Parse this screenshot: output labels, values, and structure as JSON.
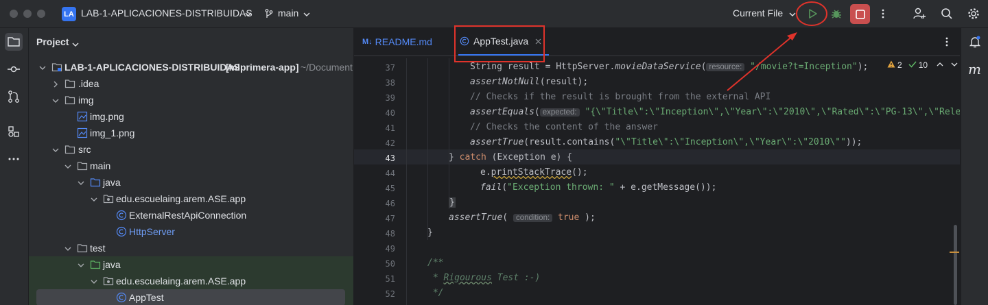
{
  "titlebar": {
    "project_badge": "LA",
    "project_name": "LAB-1-APLICACIONES-DISTRIBUIDAS",
    "branch": "main",
    "run_config": "Current File"
  },
  "sidebar": {
    "title": "Project",
    "tree": [
      {
        "label": "LAB-1-APLICACIONES-DISTRIBUIDAS",
        "bold_suffix": "[miprimera-app]",
        "path": "~/Document"
      },
      {
        "label": ".idea"
      },
      {
        "label": "img"
      },
      {
        "label": "img.png"
      },
      {
        "label": "img_1.png"
      },
      {
        "label": "src"
      },
      {
        "label": "main"
      },
      {
        "label": "java"
      },
      {
        "label": "edu.escuelaing.arem.ASE.app"
      },
      {
        "label": "ExternalRestApiConnection"
      },
      {
        "label": "HttpServer"
      },
      {
        "label": "test"
      },
      {
        "label": "java"
      },
      {
        "label": "edu.escuelaing.arem.ASE.app"
      },
      {
        "label": "AppTest"
      }
    ]
  },
  "editor": {
    "tabs": [
      {
        "label": "README.md",
        "prefix": "M↓"
      },
      {
        "label": "AppTest.java"
      }
    ],
    "inspections": {
      "warnings": "2",
      "checks": "10"
    },
    "line_numbers": [
      "37",
      "38",
      "39",
      "40",
      "41",
      "42",
      "43",
      "44",
      "45",
      "46",
      "47",
      "48",
      "49",
      "50",
      "51",
      "52"
    ],
    "code": {
      "l37_a": "String result = HttpServer.",
      "l37_b": "movieDataService",
      "l37_c": "(",
      "l37_hint": "resource:",
      "l37_str": "\"/movie?t=Inception\"",
      "l37_end": ");",
      "l38_a": "assertNotNull",
      "l38_b": "(result);",
      "l39": "// Checks if the result is brought from the external API",
      "l40_a": "assertEquals",
      "l40_b": "(",
      "l40_hint": "expected:",
      "l40_str": "\"{\\\"Title\\\":\\\"Inception\\\",\\\"Year\\\":\\\"2010\\\",\\\"Rated\\\":\\\"PG-13\\\",\\\"Rele",
      "l41": "// Checks the content of the answer",
      "l42_a": "assertTrue",
      "l42_b": "(result.contains(",
      "l42_str": "\"\\\"Title\\\":\\\"Inception\\\",\\\"Year\\\":\\\"2010\\\"\"",
      "l42_end": "));",
      "l43_a": "} ",
      "l43_kw": "catch",
      "l43_b": " (Exception e) {",
      "l44_a": "e.",
      "l44_b": "printStackTrace",
      "l44_c": "();",
      "l45_a": "fail",
      "l45_b": "(",
      "l45_str": "\"Exception thrown: \"",
      "l45_c": " + e.getMessage());",
      "l46": "}",
      "l47_a": "assertTrue",
      "l47_b": "( ",
      "l47_hint": "condition:",
      "l47_kw": "true",
      "l47_c": " );",
      "l48": "}",
      "l49": "",
      "l50": "/**",
      "l51_a": " * ",
      "l51_b": "Rigourous",
      "l51_c": " Test :-)",
      "l52": " */"
    }
  }
}
